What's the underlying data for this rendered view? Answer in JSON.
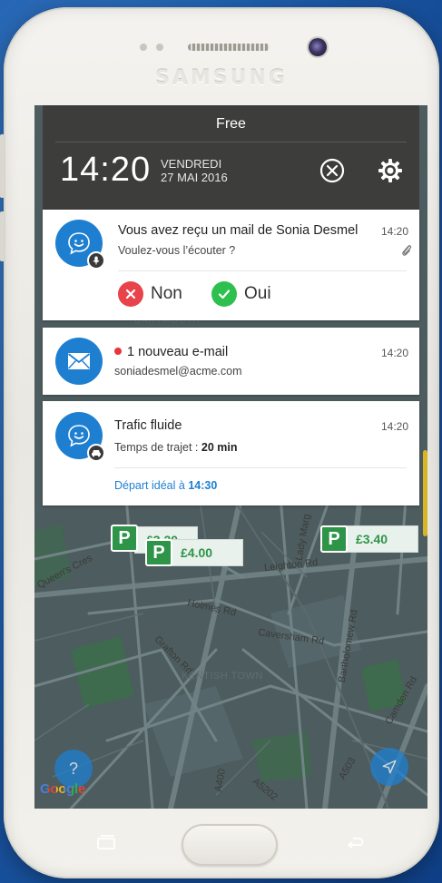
{
  "device": {
    "brand": "SAMSUNG"
  },
  "status": {
    "carrier": "Free",
    "time": "14:20",
    "day": "VENDREDI",
    "date": "27 MAI 2016"
  },
  "notifications": {
    "mail_prompt": {
      "title": "Vous avez reçu un mail de Sonia Desmel",
      "subtitle": "Voulez-vous l’écouter ?",
      "time": "14:20",
      "no_label": "Non",
      "yes_label": "Oui"
    },
    "new_email": {
      "title": "1 nouveau e-mail",
      "subtitle": "soniadesmel@acme.com",
      "time": "14:20"
    },
    "traffic": {
      "title": "Trafic fluide",
      "travel_prefix": "Temps de trajet : ",
      "travel_value": "20 min",
      "time": "14:20",
      "departure_prefix": "Départ idéal à ",
      "departure_value": "14:30"
    }
  },
  "map": {
    "parking": [
      {
        "price": "£3.20"
      },
      {
        "price": "£4.00"
      },
      {
        "price": "£3.40"
      }
    ],
    "labels": {
      "dartmouth": "DARTMOUTH",
      "lady_margaret": "Lady Marg",
      "leighton": "Leighton Rd",
      "queens": "Queen's Cres",
      "holmes": "Holmes Rd",
      "caversham": "Caversham Rd",
      "bartholomew": "Bartholomew Rd",
      "grafton": "Grafton Rd",
      "kentish": "KENTISH TOWN",
      "camden": "Camden Rd",
      "a503": "A503",
      "a400": "A400",
      "a5202": "A5202"
    },
    "help_glyph": "?",
    "google_logo": "Google"
  },
  "colors": {
    "accent_blue": "#1e7fd1",
    "success_green": "#2ec04f",
    "danger_red": "#e8434a",
    "parking_green": "#2e9448",
    "shade": "#3d3d3b"
  }
}
